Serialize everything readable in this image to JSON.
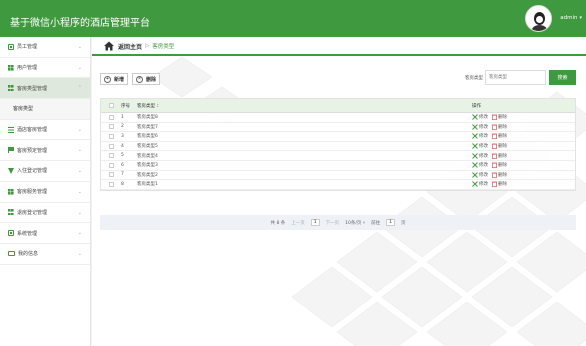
{
  "app_title": "基于微信小程序的酒店管理平台",
  "user": {
    "name": "admin",
    "caret": "▾"
  },
  "sidebar": {
    "items": [
      {
        "label": "员工管理",
        "icon": "briefcase-icon",
        "chevron": "⌄"
      },
      {
        "label": "用户管理",
        "icon": "grid-icon",
        "chevron": "⌄"
      },
      {
        "label": "客房类型管理",
        "icon": "grid-icon",
        "chevron": "⌃"
      },
      {
        "label": "客房类型",
        "sub": true
      },
      {
        "label": "酒店客房管理",
        "icon": "list-icon",
        "chevron": "⌄"
      },
      {
        "label": "客房预定管理",
        "icon": "flag-icon",
        "chevron": "⌄"
      },
      {
        "label": "入住登记管理",
        "icon": "funnel-icon",
        "chevron": "⌄"
      },
      {
        "label": "客房服务管理",
        "icon": "grid-icon",
        "chevron": "⌄"
      },
      {
        "label": "退房登记管理",
        "icon": "grid-icon",
        "chevron": "⌄"
      },
      {
        "label": "系统管理",
        "icon": "briefcase-icon",
        "chevron": "⌄"
      },
      {
        "label": "我的信息",
        "icon": "id-card-icon",
        "chevron": "⌄"
      }
    ]
  },
  "breadcrumb": {
    "home": "返回主页",
    "sep": "▷",
    "current": "客房类型"
  },
  "toolbar": {
    "add_label": "新增",
    "delete_label": "删除",
    "add_symbol": "+",
    "delete_symbol": "×"
  },
  "search": {
    "label": "客房类型",
    "placeholder": "客房类型",
    "button": "搜索"
  },
  "table": {
    "headers": {
      "no": "序号",
      "name": "客房类型",
      "sort": "↕",
      "op": "操作"
    },
    "rows": [
      {
        "no": "1",
        "name": "客房类型8"
      },
      {
        "no": "2",
        "name": "客房类型7"
      },
      {
        "no": "3",
        "name": "客房类型6"
      },
      {
        "no": "4",
        "name": "客房类型5"
      },
      {
        "no": "5",
        "name": "客房类型4"
      },
      {
        "no": "6",
        "name": "客房类型3"
      },
      {
        "no": "7",
        "name": "客房类型2"
      },
      {
        "no": "8",
        "name": "客房类型1"
      }
    ],
    "edit_label": "修改",
    "delete_label": "删除"
  },
  "pager": {
    "total": "共 8 条",
    "prev": "上一页",
    "page": "1",
    "next": "下一页",
    "per_page": "10条/页",
    "per_caret": "▾",
    "goto": "前往",
    "goto_page": "1",
    "page_unit": "页"
  },
  "colors": {
    "primary": "#3f9a3f",
    "danger": "#d9534f"
  }
}
